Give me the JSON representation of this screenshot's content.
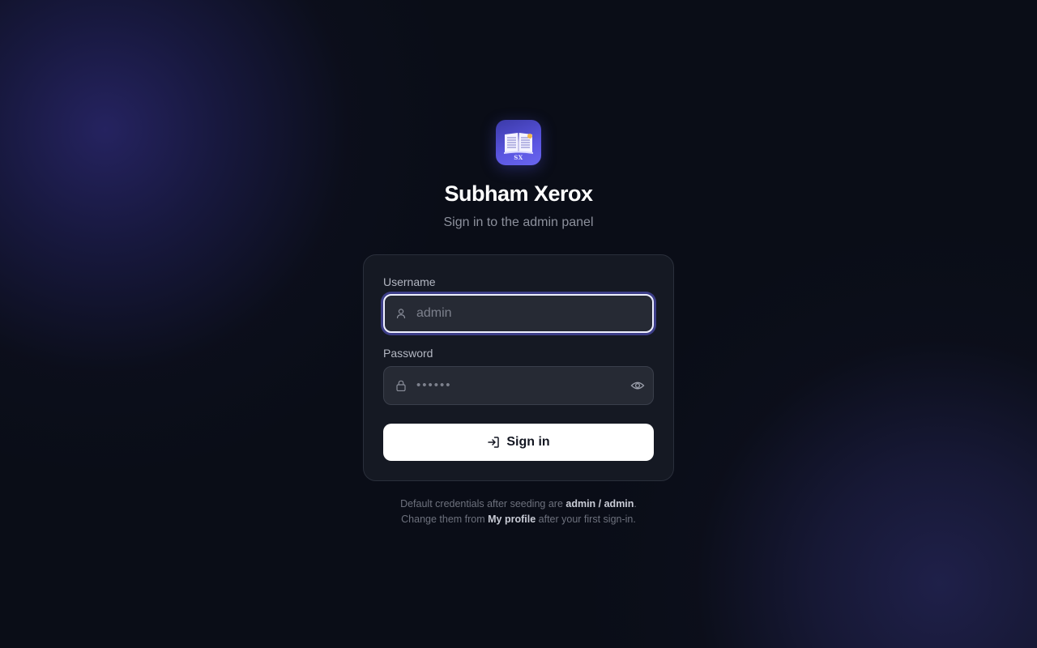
{
  "brand": {
    "logo_text": "SX",
    "title": "Subham Xerox",
    "subtitle": "Sign in to the admin panel"
  },
  "form": {
    "username_label": "Username",
    "username_placeholder": "admin",
    "password_label": "Password",
    "password_placeholder": "••••••",
    "submit_label": "Sign in"
  },
  "footer": {
    "line1_prefix": "Default credentials after seeding are ",
    "line1_strong": "admin / admin",
    "line1_suffix": ".",
    "line2_prefix": "Change them from ",
    "line2_strong": "My profile",
    "line2_suffix": " after your first sign-in."
  },
  "colors": {
    "background": "#0a0d17",
    "card": "#151923",
    "accent": "#5a55e0",
    "button": "#ffffff"
  },
  "icons": [
    "book-logo-icon",
    "user-icon",
    "lock-icon",
    "eye-icon",
    "sign-in-icon"
  ]
}
